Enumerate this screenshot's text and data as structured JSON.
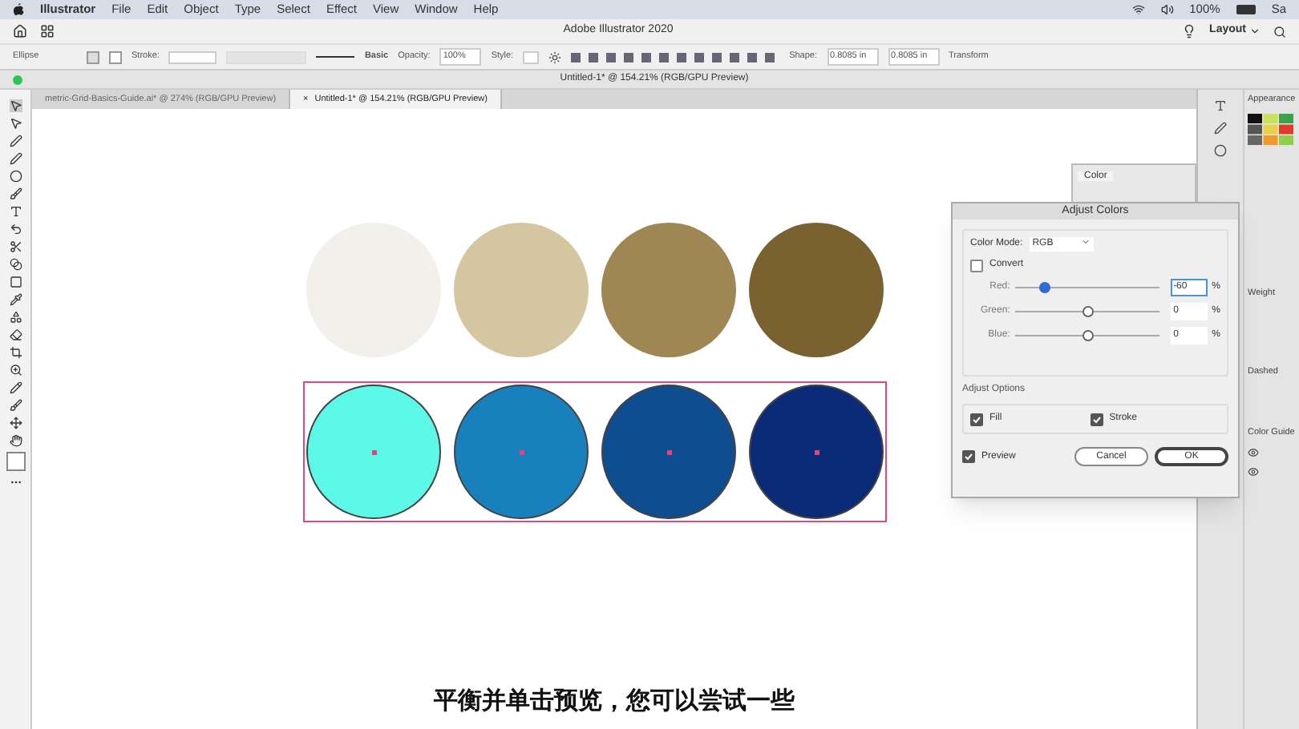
{
  "menu_bar": {
    "items": [
      "Illustrator",
      "File",
      "Edit",
      "Object",
      "Type",
      "Select",
      "Effect",
      "View",
      "Window",
      "Help"
    ],
    "battery": "100%",
    "user": "Sa"
  },
  "app_bar": {
    "title": "Adobe Illustrator 2020",
    "workspace": "Layout"
  },
  "control_bar": {
    "object": "Ellipse",
    "stroke_label": "Stroke:",
    "brush": "Basic",
    "opacity_label": "Opacity:",
    "opacity": "100%",
    "style_label": "Style:",
    "shape_label": "Shape:",
    "width": "0.8085 in",
    "height": "0.8085 in",
    "transform": "Transform"
  },
  "document": {
    "title": "Untitled-1* @ 154.21% (RGB/GPU Preview)",
    "tabs": [
      {
        "label": "metric-Grid-Basics-Guide.ai* @ 274% (RGB/GPU Preview)",
        "selected": false
      },
      {
        "label": "Untitled-1* @ 154.21% (RGB/GPU Preview)",
        "selected": true
      }
    ],
    "tab_close": "×"
  },
  "canvas": {
    "rows": [
      {
        "selected": false,
        "circles": [
          {
            "color": "#f2f0ea"
          },
          {
            "color": "#d4c6a0"
          },
          {
            "color": "#9e8752"
          },
          {
            "color": "#7a6230"
          }
        ]
      },
      {
        "selected": true,
        "circles": [
          {
            "color": "#5cf9e8"
          },
          {
            "color": "#1880bc"
          },
          {
            "color": "#0f4d91"
          },
          {
            "color": "#0b2b78"
          }
        ]
      }
    ]
  },
  "color_panel": {
    "title": "Color"
  },
  "right_dock": {
    "appearance": "Appearance",
    "weight": "Weight",
    "dashed": "Dashed",
    "color_guide": "Color Guide"
  },
  "dialog": {
    "title": "Adjust Colors",
    "color_mode_label": "Color Mode:",
    "color_mode": "RGB",
    "convert": {
      "label": "Convert",
      "checked": false
    },
    "sliders": [
      {
        "label": "Red:",
        "level": 0.2,
        "value": "-60",
        "unit": "%",
        "focused": true
      },
      {
        "label": "Green:",
        "level": 0.5,
        "value": "0",
        "unit": "%",
        "focused": false
      },
      {
        "label": "Blue:",
        "level": 0.5,
        "value": "0",
        "unit": "%",
        "focused": false
      }
    ],
    "adjust_options_label": "Adjust Options",
    "options": [
      {
        "label": "Fill",
        "checked": true
      },
      {
        "label": "Stroke",
        "checked": true
      }
    ],
    "preview": {
      "label": "Preview",
      "checked": true
    },
    "buttons": [
      {
        "label": "Cancel",
        "default": false
      },
      {
        "label": "OK",
        "default": true
      }
    ]
  },
  "subtitle": "平衡并单击预览，您可以尝试一些"
}
